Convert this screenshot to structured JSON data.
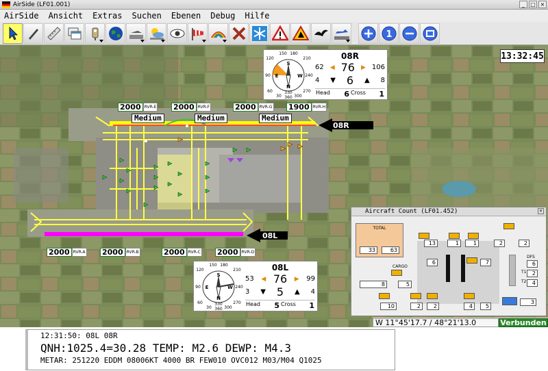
{
  "window": {
    "title": "AirSide (LF01.001)"
  },
  "menu": [
    "AirSide",
    "Ansicht",
    "Extras",
    "Suchen",
    "Ebenen",
    "Debug",
    "Hilfe"
  ],
  "toolbar": {
    "tools": [
      "pointer-tool",
      "pen-tool",
      "ruler-tool",
      "windows-tool",
      "light-tool",
      "globe-tool",
      "aircraft-layer-tool",
      "weather-layer-tool",
      "eye-tool",
      "windsock-tool",
      "rainbow-tool",
      "close-tool",
      "snowflake-tool",
      "warning-tool",
      "works-tool",
      "bird-tool",
      "runway-aircraft-tool"
    ],
    "zoom": [
      "zoom-in",
      "zoom-1",
      "zoom-out",
      "zoom-fit"
    ],
    "zoom_labels": [
      "+",
      "1",
      "−",
      ""
    ]
  },
  "clock": "13:32:45",
  "rvr_top": [
    {
      "value": "2000",
      "label": "RVR-E"
    },
    {
      "value": "2000",
      "label": "RVR-F"
    },
    {
      "value": "2000",
      "label": "RVR-G"
    },
    {
      "value": "1900",
      "label": "RVR-H"
    }
  ],
  "rvr_bottom": [
    {
      "value": "2000",
      "label": "RVR-A"
    },
    {
      "value": "2000",
      "label": "RVR-B"
    },
    {
      "value": "2000",
      "label": "RVR-C"
    },
    {
      "value": "2000",
      "label": "RVR-D"
    }
  ],
  "braking": [
    "Medium",
    "Medium",
    "Medium"
  ],
  "runway_labels": [
    "08R",
    "08L"
  ],
  "wind_08r": {
    "runway": "08R",
    "min": "62",
    "dir": "76",
    "max": "106",
    "spd_min": "4",
    "spd": "6",
    "spd_max": "8",
    "head_label": "Head",
    "head": "6",
    "cross_label": "Cross",
    "cross": "1",
    "rose_ticks": [
      "150",
      "180",
      "120",
      "210",
      "90",
      "240",
      "60",
      "270",
      "30",
      "300",
      "360",
      "330"
    ],
    "rose_letters": [
      "S",
      "E",
      "W",
      "N"
    ]
  },
  "wind_08l": {
    "runway": "08L",
    "min": "53",
    "dir": "76",
    "max": "99",
    "spd_min": "3",
    "spd": "5",
    "spd_max": "4",
    "head_label": "Head",
    "head": "5",
    "cross_label": "Cross",
    "cross": "1",
    "rose_ticks": [
      "150",
      "180",
      "120",
      "210",
      "90",
      "240",
      "60",
      "270",
      "30",
      "300",
      "360",
      "330"
    ],
    "rose_letters": [
      "S",
      "E",
      "W",
      "N"
    ]
  },
  "aircraft_count": {
    "title": "Aircraft Count (LF01.452)",
    "total_label": "TOTAL",
    "total_a": "33",
    "total_b": "63",
    "cargo_label": "CARGO",
    "dfs_label": "DFS",
    "t1_label": "T1",
    "t2_label": "T2",
    "boxes": [
      {
        "id": "n13",
        "v": "13"
      },
      {
        "id": "n1a",
        "v": "1"
      },
      {
        "id": "n1b",
        "v": "1"
      },
      {
        "id": "n2a",
        "v": "2"
      },
      {
        "id": "n2b",
        "v": "2"
      },
      {
        "id": "n6",
        "v": "6"
      },
      {
        "id": "n7a",
        "v": "7"
      },
      {
        "id": "n7b",
        "v": "7"
      },
      {
        "id": "n8",
        "v": "8"
      },
      {
        "id": "n5",
        "v": "5"
      },
      {
        "id": "n10",
        "v": "10"
      },
      {
        "id": "n2c",
        "v": "2"
      },
      {
        "id": "n2d",
        "v": "2"
      },
      {
        "id": "n4",
        "v": "4"
      },
      {
        "id": "n5b",
        "v": "5"
      },
      {
        "id": "dfs",
        "v": "6"
      },
      {
        "id": "t1",
        "v": "2"
      },
      {
        "id": "t2",
        "v": "4"
      },
      {
        "id": "n3",
        "v": "3"
      }
    ]
  },
  "status": {
    "coord": "11°45'17.7 / 48°21'13.0",
    "coord_prefix": "W",
    "conn": "Verbunden"
  },
  "metar": {
    "line1": "12:31:50: 08L 08R",
    "line2": "QNH:1025.4=30.28 TEMP: M2.6 DEWP: M4.3",
    "line3": "METAR: 251220 EDDM 08006KT 4000 BR FEW010 OVC012 M03/M04 Q1025"
  },
  "colors": {
    "rvr_green": "#2a7a2a",
    "runway_yellow": "#ffff00",
    "runway_magenta": "#ff00ff",
    "conn_green": "#2a8a2a",
    "badge_orange": "#f0b000"
  }
}
